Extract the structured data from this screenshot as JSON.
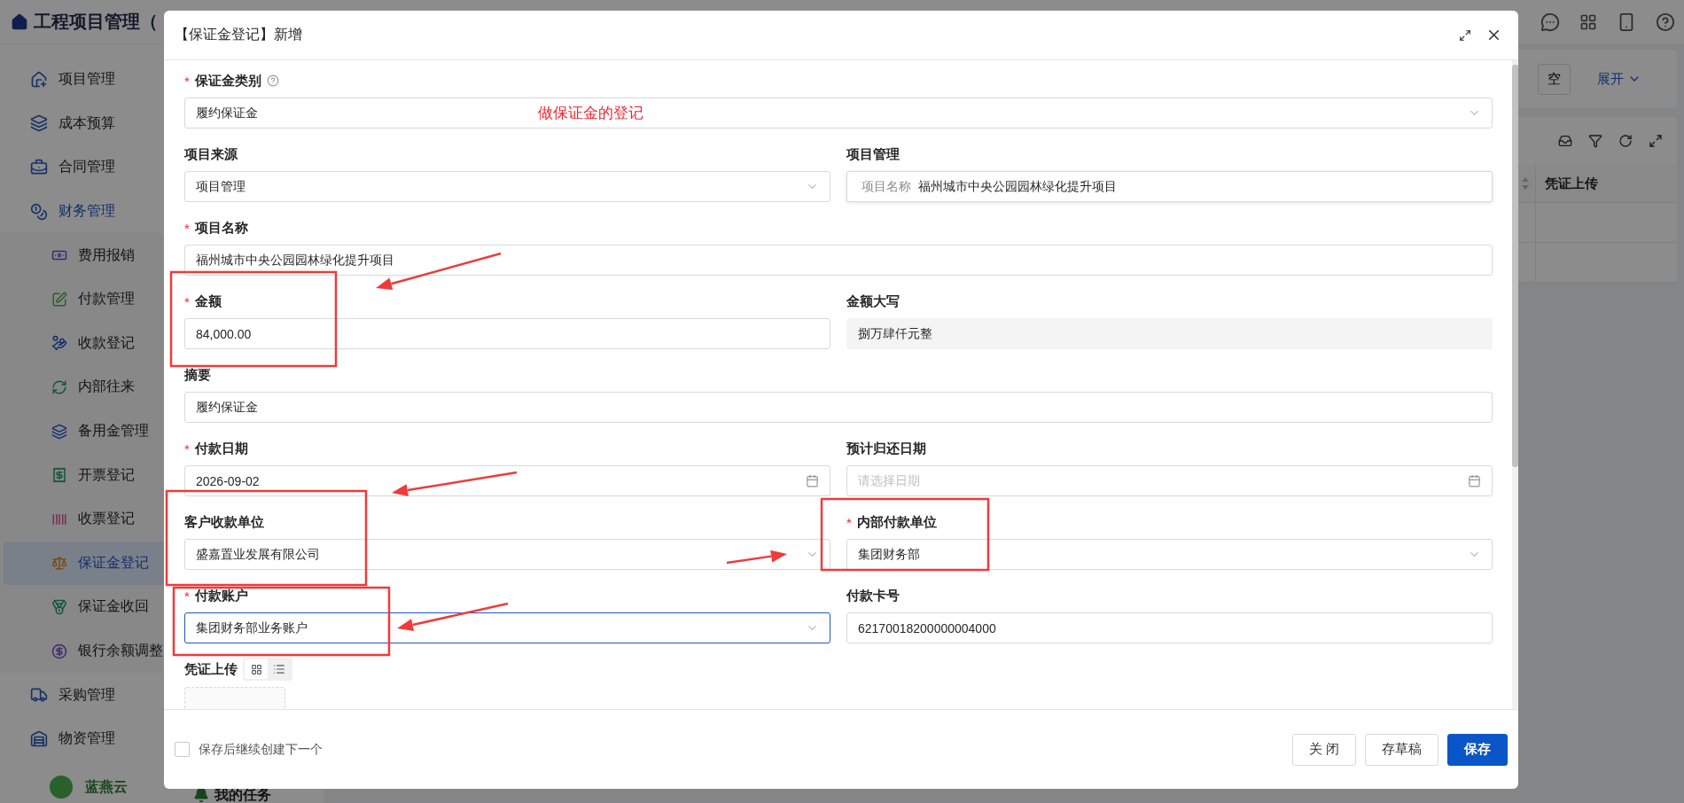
{
  "app": {
    "title": "工程项目管理（"
  },
  "sidebar": {
    "items": [
      {
        "label": "项目管理",
        "selected": false,
        "expanded": false
      },
      {
        "label": "成本预算",
        "selected": false,
        "expanded": false
      },
      {
        "label": "合同管理",
        "selected": false,
        "expanded": false
      },
      {
        "label": "财务管理",
        "selected": false,
        "expanded": true,
        "children": [
          {
            "label": "费用报销",
            "selected": false
          },
          {
            "label": "付款管理",
            "selected": false
          },
          {
            "label": "收款登记",
            "selected": false
          },
          {
            "label": "内部往来",
            "selected": false
          },
          {
            "label": "备用金管理",
            "selected": false
          },
          {
            "label": "开票登记",
            "selected": false
          },
          {
            "label": "收票登记",
            "selected": false
          },
          {
            "label": "保证金登记",
            "selected": true
          },
          {
            "label": "保证金收回",
            "selected": false
          },
          {
            "label": "银行余额调整",
            "selected": false
          }
        ]
      },
      {
        "label": "采购管理",
        "selected": false,
        "expanded": false
      },
      {
        "label": "物资管理",
        "selected": false,
        "expanded": false
      }
    ],
    "brand": "蓝燕云",
    "task": "我的任务"
  },
  "search_panel": {
    "clear_button": "空",
    "expand_link": "展开"
  },
  "table": {
    "columns": [
      "凭证上传"
    ]
  },
  "dialog": {
    "title": "【保证金登记】新增",
    "rows": [
      [
        {
          "label": "保证金类别",
          "mark": "*",
          "help": true,
          "kind": "select",
          "value": "履约保证金",
          "focused": false,
          "annotation": "做保证金的登记"
        }
      ],
      [
        {
          "label": "项目来源",
          "kind": "select",
          "value": "项目管理",
          "focused": false
        },
        {
          "label": "项目管理",
          "kind": "prefixed",
          "prefix": "项目名称",
          "value": "福州城市中央公园园林绿化提升项目",
          "focused": false
        }
      ],
      [
        {
          "label": "项目名称",
          "mark": "*",
          "kind": "input",
          "value": "福州城市中央公园园林绿化提升项目",
          "focused": false
        }
      ],
      [
        {
          "label": "金额",
          "mark": "*",
          "kind": "input",
          "value": "84,000.00",
          "focused": false
        },
        {
          "label": "金额大写",
          "kind": "readonly",
          "value": "捌万肆仟元整",
          "focused": false
        }
      ],
      [
        {
          "label": "摘要",
          "kind": "input",
          "value": "履约保证金",
          "focused": false
        }
      ],
      [
        {
          "label": "付款日期",
          "mark": "*",
          "kind": "date",
          "value": "2026-09-02",
          "focused": false
        },
        {
          "label": "预计归还日期",
          "kind": "date",
          "placeholder": "请选择日期",
          "focused": false
        }
      ],
      [
        {
          "label": "客户收款单位",
          "kind": "select",
          "value": "盛嘉置业发展有限公司",
          "focused": false
        },
        {
          "label": "内部付款单位",
          "mark": "*",
          "kind": "select",
          "value": "集团财务部",
          "focused": false
        }
      ],
      [
        {
          "label": "付款账户",
          "mark": "*",
          "kind": "select",
          "value": "集团财务部业务账户",
          "focused": true
        },
        {
          "label": "付款卡号",
          "kind": "input",
          "value": "62170018200000004000",
          "focused": false
        }
      ]
    ],
    "upload": {
      "label": "凭证上传",
      "view_modes": [
        {
          "kind": "grid",
          "selected": true
        },
        {
          "kind": "list",
          "selected": false
        }
      ]
    },
    "continue_checkbox": {
      "label": "保存后继续创建下一个",
      "checked": false
    },
    "buttons": [
      {
        "label": "关 闭",
        "kind": "default"
      },
      {
        "label": "存草稿",
        "kind": "default"
      },
      {
        "label": "保存",
        "kind": "primary"
      }
    ]
  }
}
